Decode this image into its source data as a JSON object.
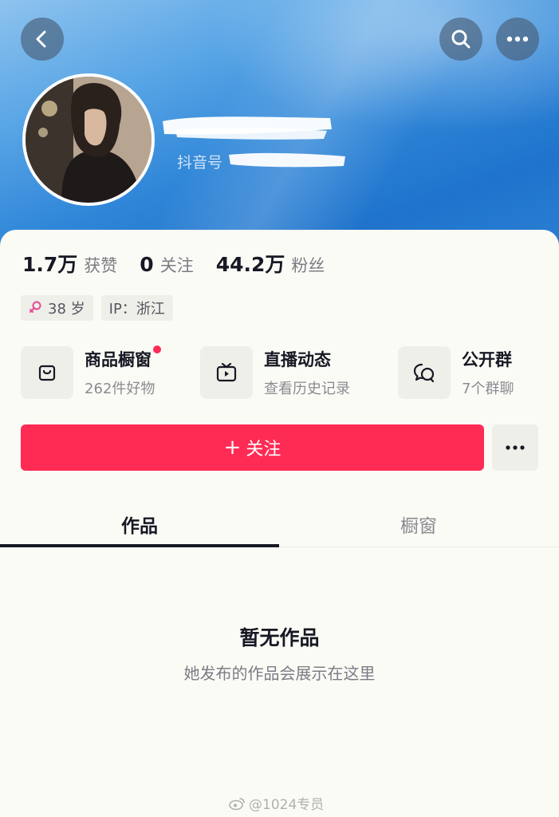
{
  "header": {
    "back_icon": "chevron-left-icon",
    "search_icon": "search-icon",
    "more_icon": "more-horizontal-icon"
  },
  "profile": {
    "douyin_id_label": "抖音号"
  },
  "stats": [
    {
      "value": "1.7万",
      "label": "获赞"
    },
    {
      "value": "0",
      "label": "关注"
    },
    {
      "value": "44.2万",
      "label": "粉丝"
    }
  ],
  "tags": {
    "age": "38 岁",
    "ip": "IP：浙江",
    "gender_icon": "female-icon"
  },
  "features": [
    {
      "title": "商品橱窗",
      "subtitle": "262件好物",
      "icon": "shopping-bag-icon",
      "has_dot": true
    },
    {
      "title": "直播动态",
      "subtitle": "查看历史记录",
      "icon": "tv-icon",
      "has_dot": false
    },
    {
      "title": "公开群",
      "subtitle": "7个群聊",
      "icon": "chat-bubbles-icon",
      "has_dot": false
    }
  ],
  "actions": {
    "follow_plus": "+",
    "follow_label": "关注"
  },
  "tabs": [
    {
      "label": "作品",
      "active": true
    },
    {
      "label": "橱窗",
      "active": false
    }
  ],
  "empty_state": {
    "title": "暂无作品",
    "subtitle": "她发布的作品会展示在这里"
  },
  "watermark": {
    "text": "@1024专员"
  },
  "colors": {
    "accent": "#fe2c55",
    "banner_blue": "#2f86d8",
    "text_primary": "#161823",
    "text_secondary": "#7b7c84"
  }
}
